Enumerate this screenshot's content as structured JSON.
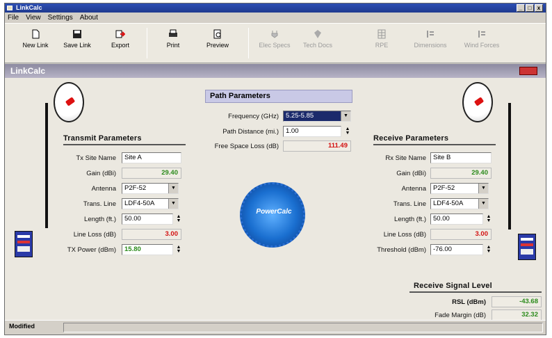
{
  "window": {
    "title": "LinkCalc",
    "buttons": [
      "_",
      "□",
      "x"
    ]
  },
  "menu": [
    "File",
    "View",
    "Settings",
    "About"
  ],
  "toolbar": {
    "new_link": "New Link",
    "save_link": "Save Link",
    "export": "Export",
    "print": "Print",
    "preview": "Preview",
    "elec_specs": "Elec Specs",
    "tech_docs": "Tech Docs",
    "rpe": "RPE",
    "dimensions": "Dimensions",
    "wind_forces": "Wind Forces"
  },
  "app_header": "LinkCalc",
  "path": {
    "heading": "Path Parameters",
    "freq_label": "Frequency (GHz)",
    "freq_value": "5.25-5.85",
    "dist_label": "Path Distance (mi.)",
    "dist_value": "1.00",
    "fsl_label": "Free Space Loss (dB)",
    "fsl_value": "111.49"
  },
  "tx": {
    "heading": "Transmit Parameters",
    "site_label": "Tx Site Name",
    "site_value": "Site A",
    "gain_label": "Gain (dBi)",
    "gain_value": "29.40",
    "antenna_label": "Antenna",
    "antenna_value": "P2F-52",
    "line_label": "Trans. Line",
    "line_value": "LDF4-50A",
    "length_label": "Length (ft.)",
    "length_value": "50.00",
    "loss_label": "Line Loss (dB)",
    "loss_value": "3.00",
    "power_label": "TX Power (dBm)",
    "power_value": "15.80"
  },
  "rx": {
    "heading": "Receive Parameters",
    "site_label": "Rx Site Name",
    "site_value": "Site B",
    "gain_label": "Gain (dBi)",
    "gain_value": "29.40",
    "antenna_label": "Antenna",
    "antenna_value": "P2F-52",
    "line_label": "Trans. Line",
    "line_value": "LDF4-50A",
    "length_label": "Length (ft.)",
    "length_value": "50.00",
    "loss_label": "Line Loss (dB)",
    "loss_value": "3.00",
    "threshold_label": "Threshold (dBm)",
    "threshold_value": "-76.00"
  },
  "rsl": {
    "heading": "Receive Signal Level",
    "rsl_label": "RSL (dBm)",
    "rsl_value": "-43.68",
    "fade_label": "Fade Margin (dB)",
    "fade_value": "32.32"
  },
  "logo_text": "PowerCalc",
  "status": "Modified",
  "colors": {
    "green": "#2a8a1a",
    "red": "#d31010",
    "title": "#1f3a8f"
  }
}
